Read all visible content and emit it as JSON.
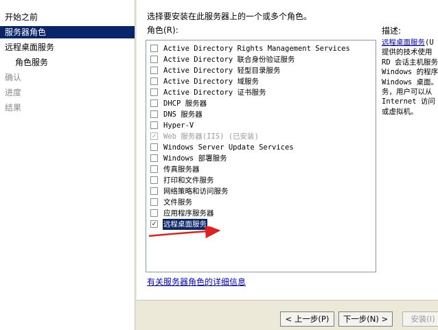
{
  "sidebar": {
    "items": [
      {
        "label": "开始之前",
        "state": "normal"
      },
      {
        "label": "服务器角色",
        "state": "selected"
      },
      {
        "label": "远程桌面服务",
        "state": "normal"
      },
      {
        "label": "角色服务",
        "state": "sub"
      },
      {
        "label": "确认",
        "state": "disabled"
      },
      {
        "label": "进度",
        "state": "disabled"
      },
      {
        "label": "结果",
        "state": "disabled"
      }
    ]
  },
  "main": {
    "instruction": "选择要安装在此服务器上的一个或多个角色。",
    "roles_label": "角色(R):",
    "description_label": "描述:",
    "description_link": "远程桌面服务",
    "description_first_tail": "(U",
    "description_lines": [
      "提供的技术使用",
      "RD 会话主机服务",
      "Windows 的程序",
      "Windows 桌面。",
      "务，用户可以从",
      "Internet 访问",
      "或虚拟机。"
    ],
    "roles": [
      {
        "label": "Active Directory Rights Management Services",
        "checked": false,
        "disabled": false
      },
      {
        "label": "Active Directory 联合身份验证服务",
        "checked": false,
        "disabled": false
      },
      {
        "label": "Active Directory 轻型目录服务",
        "checked": false,
        "disabled": false
      },
      {
        "label": "Active Directory 域服务",
        "checked": false,
        "disabled": false
      },
      {
        "label": "Active Directory 证书服务",
        "checked": false,
        "disabled": false
      },
      {
        "label": "DHCP 服务器",
        "checked": false,
        "disabled": false
      },
      {
        "label": "DNS 服务器",
        "checked": false,
        "disabled": false
      },
      {
        "label": "Hyper-V",
        "checked": false,
        "disabled": false
      },
      {
        "label": "Web 服务器(IIS)  (已安装)",
        "checked": true,
        "disabled": true
      },
      {
        "label": "Windows Server Update Services",
        "checked": false,
        "disabled": false
      },
      {
        "label": "Windows 部署服务",
        "checked": false,
        "disabled": false
      },
      {
        "label": "传真服务器",
        "checked": false,
        "disabled": false
      },
      {
        "label": "打印和文件服务",
        "checked": false,
        "disabled": false
      },
      {
        "label": "网络策略和访问服务",
        "checked": false,
        "disabled": false
      },
      {
        "label": "文件服务",
        "checked": false,
        "disabled": false
      },
      {
        "label": "应用程序服务器",
        "checked": false,
        "disabled": false
      },
      {
        "label": "远程桌面服务",
        "checked": true,
        "disabled": false,
        "selected": true
      }
    ],
    "more_info_link": "有关服务器角色的详细信息",
    "annotation_color": "#e02020"
  },
  "buttons": {
    "back": "< 上一步(P)",
    "next": "下一步(N) >",
    "install": "安装(I)"
  }
}
